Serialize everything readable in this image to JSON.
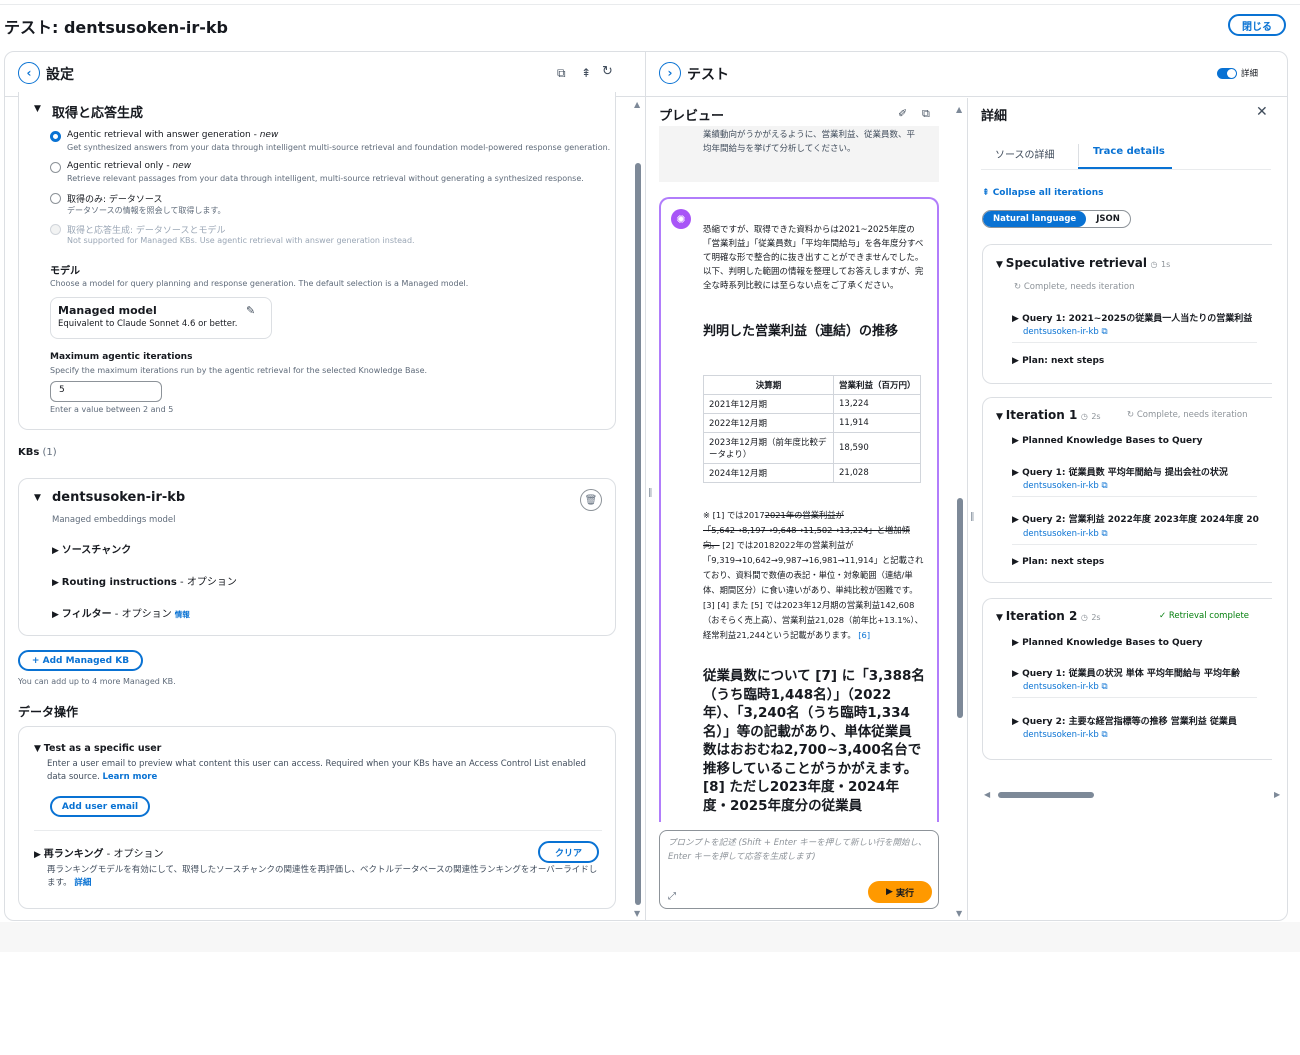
{
  "page_title": "テスト: dentsusoken-ir-kb",
  "close_label": "閉じる",
  "settings": {
    "title": "設定",
    "section_title": "取得と応答生成",
    "options": [
      {
        "label": "Agentic retrieval with answer generation - ",
        "badge": "new",
        "desc": "Get synthesized answers from your data through intelligent multi-source retrieval and foundation model-powered response generation."
      },
      {
        "label": "Agentic retrieval only - ",
        "badge": "new",
        "desc": "Retrieve relevant passages from your data through intelligent, multi-source retrieval without generating a synthesized response."
      },
      {
        "label": "取得のみ: データソース",
        "badge": "",
        "desc": "データソースの情報を照会して取得します。"
      },
      {
        "label": "取得と応答生成: データソースとモデル",
        "badge": "",
        "desc": "Not supported for Managed KBs. Use agentic retrieval with answer generation instead."
      }
    ],
    "model_label": "モデル",
    "model_desc": "Choose a model for query planning and response generation. The default selection is a Managed model.",
    "model_name": "Managed model",
    "model_sub": "Equivalent to Claude Sonnet 4.6 or better.",
    "iter_label": "Maximum agentic iterations",
    "iter_desc": "Specify the maximum iterations run by the agentic retrieval for the selected Knowledge Base.",
    "iter_value": "5",
    "iter_hint": "Enter a value between 2 and 5",
    "kbs_label": "KBs",
    "kbs_count": "(1)",
    "kb_name": "dentsusoken-ir-kb",
    "kb_sub": "Managed embeddings model",
    "kb_items": [
      "ソースチャンク",
      "Routing instructions",
      "フィルター"
    ],
    "kb_item_suffix": [
      "",
      " - オプション",
      " - オプション"
    ],
    "filter_info": "情報",
    "add_kb": "Add Managed KB",
    "add_kb_hint": "You can add up to 4 more Managed KB.",
    "data_ops": "データ操作",
    "test_user_title": "Test as a specific user",
    "test_user_desc": "Enter a user email to preview what content this user can access. Required when your KBs have an Access Control List enabled data source.",
    "learn_more": "Learn more",
    "add_user_email": "Add user email",
    "rerank_title": "再ランキング",
    "rerank_suffix": " - オプション",
    "clear": "クリア",
    "rerank_desc": "再ランキングモデルを有効にして、取得したソースチャンクの関連性を再評価し、ベクトルデータベースの関連性ランキングをオーバーライドします。",
    "detail_link": "詳細"
  },
  "test": {
    "title": "テスト",
    "details_toggle": "詳細",
    "preview": "プレビュー",
    "prompt_tail": "業績動向がうかがえるように、営業利益、従業員数、平均年間給与を挙げて分析してください。",
    "resp_intro": "恐縮ですが、取得できた資料からは2021~2025年度の「営業利益」「従業員数」「平均年間給与」を各年度分すべて明確な形で整合的に抜き出すことができませんでした。以下、判明した範囲の情報を整理してお答えしますが、完全な時系列比較には至らない点をご了承ください。",
    "h_profit": "判明した営業利益（連結）の推移",
    "table_head": [
      "決算期",
      "営業利益（百万円）"
    ],
    "table_rows": [
      [
        "2021年12月期",
        "13,224"
      ],
      [
        "2022年12月期",
        "11,914"
      ],
      [
        "2023年12月期（前年度比較データより）",
        "18,590"
      ],
      [
        "2024年12月期",
        "21,028"
      ]
    ],
    "note_1": "※ [1] では2017",
    "note_strike": "2021年の営業利益が「5,642→8,197→9,648→11,502→13,224」と増加傾向。",
    "note_2": "[2] では2018",
    "note_3": "2022年の営業利益が「9,319→10,642→9,987→16,981→11,914」と記載されており、資料間で数値の表記・単位・対象範囲（連結/単体、期間区分）に食い違いがあり、単純比較が困難です。",
    "note_4": "[3] [4] また [5] では2023年12月期の営業利益142,608（おそらく売上高）、営業利益21,028（前年比+13.1%）、経常利益21,244という記載があります。",
    "note_6": "[6]",
    "emp_text": "従業員数について [7] に「3,388名（うち臨時1,448名）」（2022年）、「3,240名（うち臨時1,334名）」等の記載があり、単体従業員数はおおむね2,700~3,400名台で推移していることがうかがえます。 [8] ただし2023年度・2024年度・2025年度分の従業員",
    "input_placeholder": "プロンプトを記述 (Shift + Enter キーを押して新しい行を開始し、Enter キーを押して応答を生成します)",
    "run": "実行"
  },
  "details": {
    "title": "詳細",
    "tabs": [
      "ソースの詳細",
      "Trace details"
    ],
    "collapse": "Collapse all iterations",
    "seg": [
      "Natural language",
      "JSON"
    ],
    "spec_title": "Speculative retrieval",
    "spec_time": "1s",
    "spec_status": "Complete, needs iteration",
    "spec_q1": "Query 1: 2021~2025の従業員一人当たりの営業利益",
    "spec_q1_src": "dentsusoken-ir-kb",
    "spec_plan": "Plan: next steps",
    "it1_title": "Iteration 1",
    "it1_time": "2s",
    "it1_status": "Complete, needs iteration",
    "it1_planned": "Planned Knowledge Bases to Query",
    "it1_q1": "Query 1: 従業員数 平均年間給与 提出会社の状況",
    "it1_q1_src": "dentsusoken-ir-kb",
    "it1_q2": "Query 2: 営業利益 2022年度 2023年度 2024年度 20",
    "it1_q2_src": "dentsusoken-ir-kb",
    "it1_plan": "Plan: next steps",
    "it2_title": "Iteration 2",
    "it2_time": "2s",
    "it2_status": "Retrieval complete",
    "it2_planned": "Planned Knowledge Bases to Query",
    "it2_q1": "Query 1: 従業員の状況 単体 平均年間給与 平均年齢",
    "it2_q1_src": "dentsusoken-ir-kb",
    "it2_q2": "Query 2: 主要な経営指標等の推移 営業利益 従業員",
    "it2_q2_src": "dentsusoken-ir-kb"
  }
}
